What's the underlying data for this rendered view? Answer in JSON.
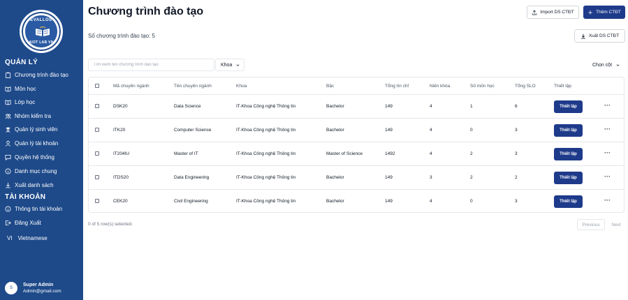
{
  "sidebar": {
    "logo": {
      "top_text": "EVALLOS",
      "bottom_text": "AIOT LAB VN"
    },
    "section_manage": "QUẢN LÝ",
    "items": [
      {
        "label": "Chương trình đào tạo",
        "icon": "clipboard-icon"
      },
      {
        "label": "Môn học",
        "icon": "book-icon"
      },
      {
        "label": "Lớp học",
        "icon": "book-open-icon"
      },
      {
        "label": "Nhóm kiểm tra",
        "icon": "users-icon"
      },
      {
        "label": "Quản lý sinh viên",
        "icon": "user-graduate-icon"
      },
      {
        "label": "Quản lý tài khoản",
        "icon": "user-icon"
      },
      {
        "label": "Quyền hệ thống",
        "icon": "message-square-icon"
      },
      {
        "label": "Danh mục chung",
        "icon": "info-circle-icon"
      },
      {
        "label": "Xuất danh sách",
        "icon": "download-icon"
      }
    ],
    "section_account": "TÀI KHOẢN",
    "account_items": [
      {
        "label": "Thông tin tài khoản",
        "icon": "info-circle-icon"
      },
      {
        "label": "Đăng Xuất",
        "icon": "logout-icon"
      }
    ],
    "language": {
      "code": "VI",
      "label": "Vietnamese"
    },
    "user": {
      "avatar": "S",
      "name": "Super Admin",
      "email": "Admin@gmail.com"
    }
  },
  "header": {
    "title": "Chương trình đào tạo",
    "import_label": "Import DS CTĐT",
    "add_label": "Thêm CTĐT",
    "export_label": "Xuất DS CTĐT"
  },
  "summary": {
    "count_text": "Số chương trình đào tạo: 5"
  },
  "filters": {
    "search_placeholder": "Tìm kiếm tên chương trình đào tạo",
    "department_label": "Khoa",
    "columns_label": "Chọn cột"
  },
  "table": {
    "columns": [
      "Mã chuyên ngành",
      "Tên chuyên ngành",
      "Khoa",
      "Bậc",
      "Tổng tín chỉ",
      "Niên khóa",
      "Số môn học",
      "Tổng SLO",
      "Thiết lập"
    ],
    "setup_label": "Thiết lập",
    "more_label": "···",
    "rows": [
      [
        "DSK20",
        "Data Science",
        "IT-Khoa Công nghệ Thông tin",
        "Bachelor",
        "149",
        "4",
        "1",
        "6"
      ],
      [
        "ITK20",
        "Computer Science",
        "IT-Khoa Công nghệ Thông tin",
        "Bachelor",
        "149",
        "4",
        "0",
        "3"
      ],
      [
        "IT204IU",
        "Master of IT",
        "IT-Khoa Công nghệ Thông tin",
        "Master of Science",
        "1492",
        "4",
        "2",
        "3"
      ],
      [
        "ITDS20",
        "Data Engineering",
        "IT-Khoa Công nghệ Thông tin",
        "Bachelor",
        "149",
        "3",
        "2",
        "2"
      ],
      [
        "CEK20",
        "Civil Engineering",
        "IT-Khoa Công nghệ Thông tin",
        "Bachelor",
        "149",
        "4",
        "0",
        "3"
      ]
    ]
  },
  "footer": {
    "selected_text": "0 of 5 row(s) selected.",
    "previous_label": "Previous",
    "next_label": "Next"
  },
  "colors": {
    "sidebar": "#1e4a8a",
    "primary": "#1e3a8a",
    "border": "#e5e7eb"
  }
}
